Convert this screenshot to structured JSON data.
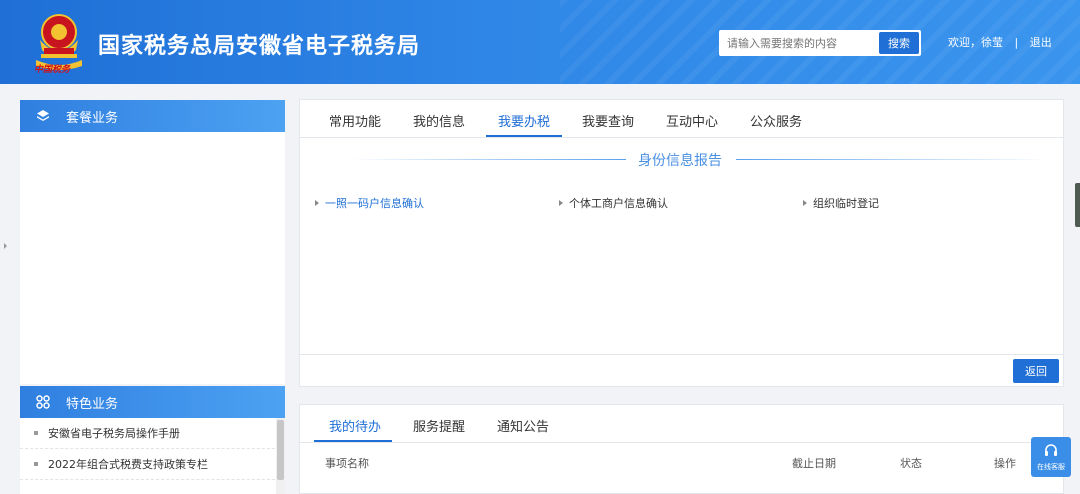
{
  "header": {
    "title": "国家税务总局安徽省电子税务局",
    "search_placeholder": "请输入需要搜索的内容",
    "search_button": "搜索",
    "welcome": "欢迎，徐莹",
    "separator": "|",
    "logout": "退出",
    "logo_text": "中国税务"
  },
  "sidebar": {
    "package_title": "套餐业务",
    "special_title": "特色业务",
    "special_items": [
      {
        "label": "安徽省电子税务局操作手册"
      },
      {
        "label": "2022年组合式税费支持政策专栏"
      }
    ]
  },
  "main": {
    "tabs": [
      {
        "label": "常用功能"
      },
      {
        "label": "我的信息"
      },
      {
        "label": "我要办税"
      },
      {
        "label": "我要查询"
      },
      {
        "label": "互动中心"
      },
      {
        "label": "公众服务"
      }
    ],
    "active_tab": "我要办税",
    "section_title": "身份信息报告",
    "functions": [
      {
        "label": "一照一码户信息确认"
      },
      {
        "label": "个体工商户信息确认"
      },
      {
        "label": "组织临时登记"
      }
    ],
    "back_button": "返回"
  },
  "todo": {
    "tabs": [
      {
        "label": "我的待办"
      },
      {
        "label": "服务提醒"
      },
      {
        "label": "通知公告"
      }
    ],
    "columns": {
      "name": "事项名称",
      "deadline": "截止日期",
      "status": "状态",
      "action": "操作"
    }
  },
  "support": {
    "label": "在线客服"
  },
  "colors": {
    "primary": "#1f6fd6",
    "header_gradient_end": "#3a95ee",
    "section_title": "#4a90e2"
  }
}
